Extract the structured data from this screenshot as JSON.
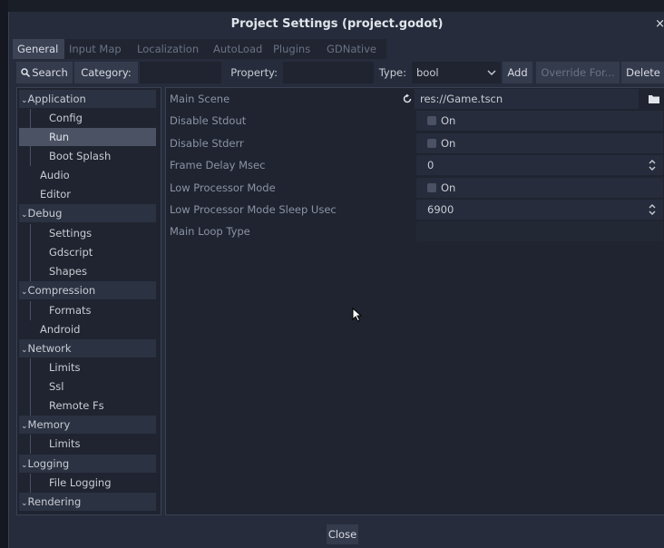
{
  "window": {
    "title": "Project Settings (project.godot)",
    "close_glyph": "×"
  },
  "tabs": [
    {
      "label": "General",
      "active": true
    },
    {
      "label": "Input Map"
    },
    {
      "label": "Localization"
    },
    {
      "label": "AutoLoad"
    },
    {
      "label": "Plugins"
    },
    {
      "label": "GDNative"
    }
  ],
  "toolbar": {
    "search_label": "Search",
    "category_label": "Category:",
    "category_value": "",
    "property_label": "Property:",
    "property_value": "",
    "type_label": "Type:",
    "type_value": "bool",
    "add_label": "Add",
    "override_label": "Override For...",
    "delete_label": "Delete"
  },
  "sidebar": {
    "items": [
      {
        "label": "Application",
        "kind": "section"
      },
      {
        "label": "Config",
        "kind": "child"
      },
      {
        "label": "Run",
        "kind": "child",
        "selected": true
      },
      {
        "label": "Boot Splash",
        "kind": "child"
      },
      {
        "label": "Audio",
        "kind": "top"
      },
      {
        "label": "Editor",
        "kind": "top"
      },
      {
        "label": "Debug",
        "kind": "section"
      },
      {
        "label": "Settings",
        "kind": "child"
      },
      {
        "label": "Gdscript",
        "kind": "child"
      },
      {
        "label": "Shapes",
        "kind": "child"
      },
      {
        "label": "Compression",
        "kind": "section"
      },
      {
        "label": "Formats",
        "kind": "child"
      },
      {
        "label": "Android",
        "kind": "top"
      },
      {
        "label": "Network",
        "kind": "section"
      },
      {
        "label": "Limits",
        "kind": "child"
      },
      {
        "label": "Ssl",
        "kind": "child"
      },
      {
        "label": "Remote Fs",
        "kind": "child"
      },
      {
        "label": "Memory",
        "kind": "section"
      },
      {
        "label": "Limits",
        "kind": "child"
      },
      {
        "label": "Logging",
        "kind": "section"
      },
      {
        "label": "File Logging",
        "kind": "child"
      },
      {
        "label": "Rendering",
        "kind": "section"
      }
    ]
  },
  "properties": [
    {
      "name": "Main Scene",
      "value": "res://Game.tscn",
      "type": "path"
    },
    {
      "name": "Disable Stdout",
      "value": "On",
      "type": "bool"
    },
    {
      "name": "Disable Stderr",
      "value": "On",
      "type": "bool"
    },
    {
      "name": "Frame Delay Msec",
      "value": "0",
      "type": "int"
    },
    {
      "name": "Low Processor Mode",
      "value": "On",
      "type": "bool"
    },
    {
      "name": "Low Processor Mode Sleep Usec",
      "value": "6900",
      "type": "int"
    },
    {
      "name": "Main Loop Type",
      "value": "",
      "type": "string"
    }
  ],
  "footer": {
    "close_label": "Close"
  },
  "colors": {
    "dialog_bg": "#262c3b",
    "panel_bg": "#1f2430",
    "selected": "#4a5263"
  }
}
